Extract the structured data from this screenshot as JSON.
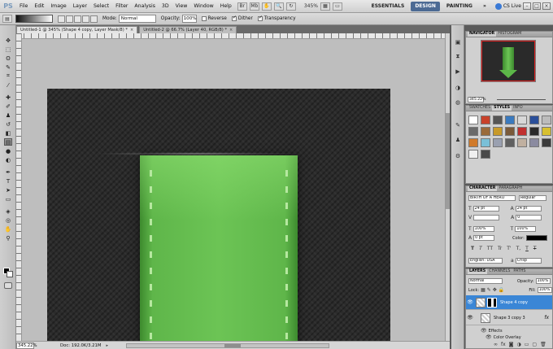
{
  "app": {
    "logo": "PS"
  },
  "menu": [
    "File",
    "Edit",
    "Image",
    "Layer",
    "Select",
    "Filter",
    "Analysis",
    "3D",
    "View",
    "Window",
    "Help"
  ],
  "menubar": {
    "zoom": "345%",
    "workspaces": [
      "ESSENTIALS",
      "DESIGN",
      "PAINTING"
    ],
    "more": "»",
    "cs_live": "CS Live",
    "win_buttons": [
      "–",
      "□",
      "×"
    ]
  },
  "options": {
    "mode_label": "Mode:",
    "mode_value": "Normal",
    "opacity_label": "Opacity:",
    "opacity_value": "100%",
    "reverse_label": "Reverse",
    "reverse_checked": false,
    "dither_label": "Dither",
    "dither_checked": true,
    "transparency_label": "Transparency",
    "transparency_checked": true
  },
  "tabs": [
    {
      "label": "Untitled-1 @ 345% (Shape 4 copy, Layer Mask/8) *",
      "active": true
    },
    {
      "label": "Untitled-2 @ 66.7% (Layer 40, RGB/8) *",
      "active": false
    }
  ],
  "status": {
    "zoom": "345.22%",
    "doc": "Doc: 192.0K/3.21M"
  },
  "navigator": {
    "tabs": [
      "NAVIGATOR",
      "HISTOGRAM"
    ],
    "zoom": "345.22%"
  },
  "styles_panel": {
    "tabs": [
      "SWATCHES",
      "STYLES",
      "INFO"
    ],
    "swatch_colors": [
      "#ffffff",
      "#c8412a",
      "#555555",
      "#3a7abf",
      "#d8d8d8",
      "#2a4f9a",
      "#bcbcbc",
      "#6a6a6a",
      "#9a6a3a",
      "#c89a2a",
      "#7a5a3a",
      "#c03030",
      "#2a2a2a",
      "#d8c030",
      "#d07a2a",
      "#7ac0d8",
      "#9aa0b0",
      "#606060",
      "#c0b0a0",
      "#8a8aa0",
      "#3a3a3a",
      "#f0f0f0",
      "#4a4a4a"
    ]
  },
  "character": {
    "tabs": [
      "CHARACTER",
      "PARAGRAPH"
    ],
    "font": "BIRTH OF A HERO",
    "style": "Regular",
    "size": "24 pt",
    "leading": "24 pt",
    "kerning": "",
    "tracking": "0",
    "vscale": "100%",
    "hscale": "100%",
    "baseline": "0 pt",
    "color_label": "Color:",
    "lang": "English: USA",
    "aa": "Crisp",
    "type_buttons": [
      "T",
      "T",
      "TT",
      "Tr",
      "T'",
      "T,",
      "T",
      "T"
    ]
  },
  "layers": {
    "tabs": [
      "LAYERS",
      "CHANNELS",
      "PATHS"
    ],
    "blend": "Normal",
    "opacity_label": "Opacity:",
    "opacity": "100%",
    "lock_label": "Lock:",
    "fill_label": "Fill:",
    "fill": "100%",
    "rows": [
      "Shape 4 copy",
      "Shape 3 copy 3"
    ],
    "effects_label": "Effects",
    "color_overlay": "Color Overlay"
  }
}
